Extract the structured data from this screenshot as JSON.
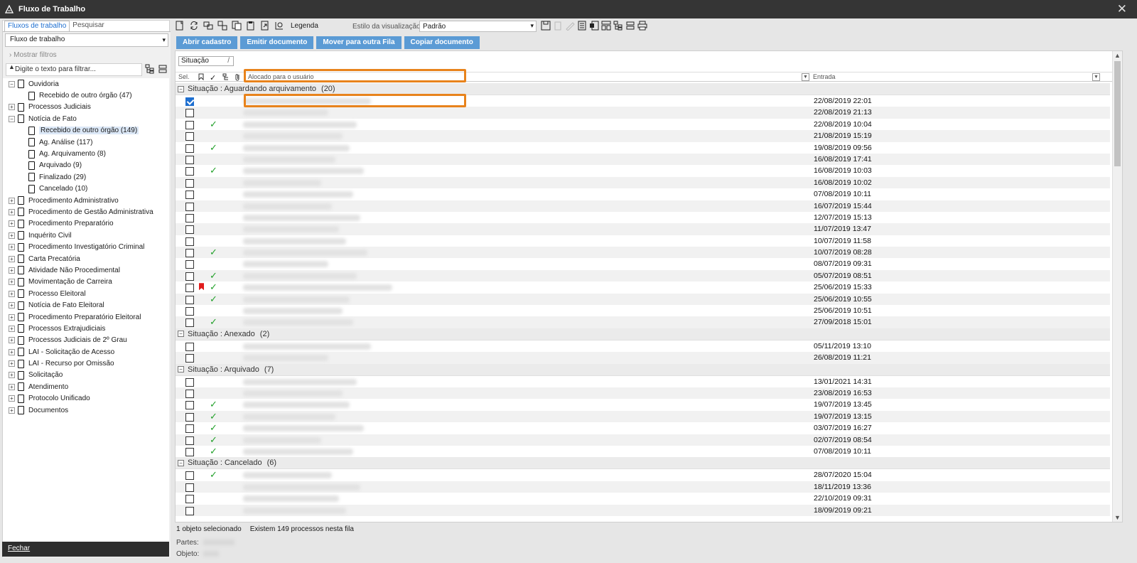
{
  "window": {
    "title": "Fluxo de Trabalho"
  },
  "left_panel": {
    "tabs": [
      "Fluxos de trabalho",
      "Pesquisar"
    ],
    "select_value": "Fluxo de trabalho",
    "show_filters": "Mostrar filtros",
    "filter_placeholder": "Digite o texto para filtrar...",
    "tree": [
      {
        "label": "Ouvidoria",
        "level": 0,
        "expanded": true
      },
      {
        "label": "Recebido de outro órgão (47)",
        "level": 1
      },
      {
        "label": "Processos Judiciais",
        "level": 0
      },
      {
        "label": "Notícia de Fato",
        "level": 0,
        "expanded": true
      },
      {
        "label": "Recebido de outro órgão (149)",
        "level": 1,
        "selected": true
      },
      {
        "label": "Ag. Análise (117)",
        "level": 1
      },
      {
        "label": "Ag. Arquivamento (8)",
        "level": 1
      },
      {
        "label": "Arquivado (9)",
        "level": 1
      },
      {
        "label": "Finalizado (29)",
        "level": 1
      },
      {
        "label": "Cancelado (10)",
        "level": 1
      },
      {
        "label": "Procedimento Administrativo",
        "level": 0
      },
      {
        "label": "Procedimento de Gestão Administrativa",
        "level": 0
      },
      {
        "label": "Procedimento Preparatório",
        "level": 0
      },
      {
        "label": "Inquérito Civil",
        "level": 0
      },
      {
        "label": "Procedimento Investigatório Criminal",
        "level": 0
      },
      {
        "label": "Carta Precatória",
        "level": 0
      },
      {
        "label": "Atividade Não Procedimental",
        "level": 0
      },
      {
        "label": "Movimentação de Carreira",
        "level": 0
      },
      {
        "label": "Processo Eleitoral",
        "level": 0
      },
      {
        "label": "Notícia de Fato Eleitoral",
        "level": 0
      },
      {
        "label": "Procedimento Preparatório Eleitoral",
        "level": 0
      },
      {
        "label": "Processos Extrajudiciais",
        "level": 0
      },
      {
        "label": "Processos Judiciais de 2º Grau",
        "level": 0
      },
      {
        "label": "LAI - Solicitação de Acesso",
        "level": 0
      },
      {
        "label": "LAI - Recurso por Omissão",
        "level": 0
      },
      {
        "label": "Solicitação",
        "level": 0
      },
      {
        "label": "Atendimento",
        "level": 0
      },
      {
        "label": "Protocolo Unificado",
        "level": 0
      },
      {
        "label": "Documentos",
        "level": 0
      }
    ],
    "close_button": "Fechar"
  },
  "toolbar": {
    "legend": "Legenda",
    "viz_label": "Estilo da visualização",
    "viz_value": "Padrão"
  },
  "actions": [
    "Abrir cadastro",
    "Emitir documento",
    "Mover para outra Fila",
    "Copiar documento"
  ],
  "grid": {
    "group_by": "Situação",
    "columns": {
      "sel": "Sel.",
      "allocated": "Alocado para o usuário",
      "entry": "Entrada"
    },
    "groups": [
      {
        "label": "Situação : Aguardando arquivamento",
        "count": "(20)",
        "rows": [
          {
            "date": "22/08/2019 22:01",
            "checked": true,
            "ok": false
          },
          {
            "date": "22/08/2019 21:13",
            "ok": false
          },
          {
            "date": "22/08/2019 10:04",
            "ok": true
          },
          {
            "date": "21/08/2019 15:19",
            "ok": false
          },
          {
            "date": "19/08/2019 09:56",
            "ok": true
          },
          {
            "date": "16/08/2019 17:41",
            "ok": false
          },
          {
            "date": "16/08/2019 10:03",
            "ok": true
          },
          {
            "date": "16/08/2019 10:02",
            "ok": false
          },
          {
            "date": "07/08/2019 10:11",
            "ok": false
          },
          {
            "date": "16/07/2019 15:44",
            "ok": false
          },
          {
            "date": "12/07/2019 15:13",
            "ok": false
          },
          {
            "date": "11/07/2019 13:47",
            "ok": false
          },
          {
            "date": "10/07/2019 11:58",
            "ok": false
          },
          {
            "date": "10/07/2019 08:28",
            "ok": true
          },
          {
            "date": "08/07/2019 09:31",
            "ok": false
          },
          {
            "date": "05/07/2019 08:51",
            "ok": true
          },
          {
            "date": "25/06/2019 15:33",
            "ok": true,
            "flag": true
          },
          {
            "date": "25/06/2019 10:55",
            "ok": true
          },
          {
            "date": "25/06/2019 10:51",
            "ok": false
          },
          {
            "date": "27/09/2018 15:01",
            "ok": true
          }
        ]
      },
      {
        "label": "Situação : Anexado",
        "count": "(2)",
        "rows": [
          {
            "date": "05/11/2019 13:10",
            "ok": false
          },
          {
            "date": "26/08/2019 11:21",
            "ok": false
          }
        ]
      },
      {
        "label": "Situação : Arquivado",
        "count": "(7)",
        "rows": [
          {
            "date": "13/01/2021 14:31",
            "ok": false
          },
          {
            "date": "23/08/2019 16:53",
            "ok": false
          },
          {
            "date": "19/07/2019 13:45",
            "ok": true
          },
          {
            "date": "19/07/2019 13:15",
            "ok": true
          },
          {
            "date": "03/07/2019 16:27",
            "ok": true
          },
          {
            "date": "02/07/2019 08:54",
            "ok": true
          },
          {
            "date": "07/08/2019 10:11",
            "ok": true
          }
        ]
      },
      {
        "label": "Situação : Cancelado",
        "count": "(6)",
        "rows": [
          {
            "date": "28/07/2020 15:04",
            "ok": true
          },
          {
            "date": "18/11/2019 13:36",
            "ok": false
          },
          {
            "date": "22/10/2019 09:31",
            "ok": false
          },
          {
            "date": "18/09/2019 09:21",
            "ok": false
          }
        ]
      }
    ]
  },
  "status": {
    "selected": "1 objeto selecionado",
    "total": "Existem 149 processos nesta fila",
    "parts_label": "Partes:",
    "object_label": "Objeto:"
  },
  "colors": {
    "accent": "#1e6fd0",
    "action": "#5b9bd5",
    "highlight": "#e8831c",
    "ok": "#23a12b"
  }
}
